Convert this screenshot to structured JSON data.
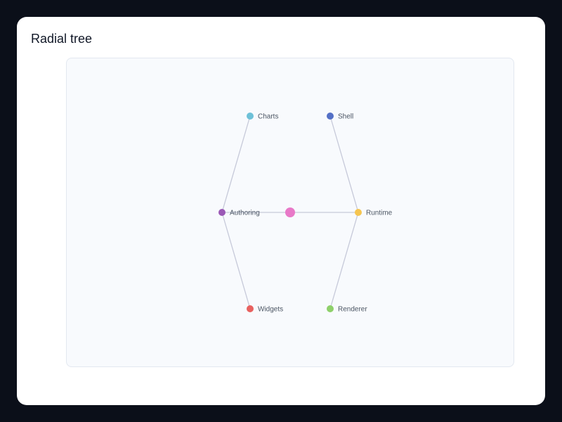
{
  "title": "Radial tree",
  "tree": {
    "root": {
      "id": "root",
      "label": "",
      "color": "#e879c8"
    },
    "children": [
      {
        "id": "authoring",
        "label": "Authoring",
        "color": "#9b59b6",
        "children": [
          {
            "id": "charts",
            "label": "Charts",
            "color": "#6ec1d8"
          },
          {
            "id": "widgets",
            "label": "Widgets",
            "color": "#e8615f"
          }
        ]
      },
      {
        "id": "runtime",
        "label": "Runtime",
        "color": "#f5c550",
        "children": [
          {
            "id": "shell",
            "label": "Shell",
            "color": "#5470c6"
          },
          {
            "id": "renderer",
            "label": "Renderer",
            "color": "#8ed06a"
          }
        ]
      }
    ]
  },
  "edge_color": "#c6c9d9"
}
